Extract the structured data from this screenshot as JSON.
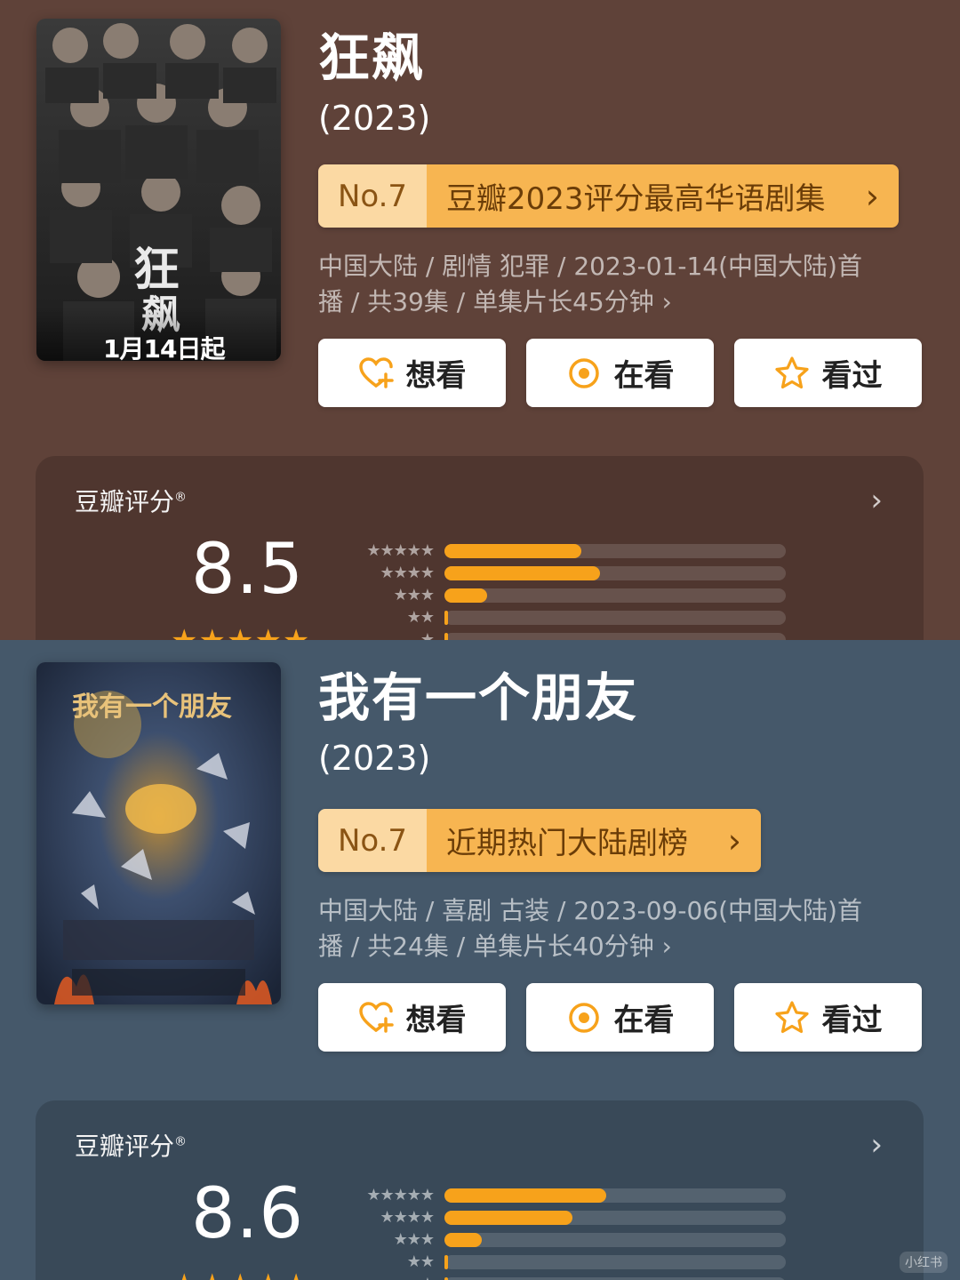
{
  "shows": [
    {
      "poster_caption": "1月14日起",
      "title": "狂飙",
      "year": "(2023)",
      "rank_no": "No.7",
      "rank_name": "豆瓣2023评分最高华语剧集",
      "meta_line1": "中国大陆 / 剧情 犯罪 / 2023-01-14(中国大陆)首",
      "meta_line2": "播 / 共39集 / 单集片长45分钟 ›",
      "actions": {
        "want": "想看",
        "watching": "在看",
        "watched": "看过"
      },
      "rating_label": "豆瓣评分",
      "score": "8.5",
      "distribution": [
        0.4,
        0.455,
        0.125,
        0.01,
        0.01
      ],
      "bg": "#5f4239"
    },
    {
      "poster_caption": "",
      "title": "我有一个朋友",
      "year": "(2023)",
      "rank_no": "No.7",
      "rank_name": "近期热门大陆剧榜",
      "meta_line1": "中国大陆 / 喜剧 古装 / 2023-09-06(中国大陆)首",
      "meta_line2": "播 / 共24集 / 单集片长40分钟 ›",
      "actions": {
        "want": "想看",
        "watching": "在看",
        "watched": "看过"
      },
      "rating_label": "豆瓣评分",
      "score": "8.6",
      "distribution": [
        0.475,
        0.375,
        0.11,
        0.01,
        0.01
      ],
      "bg": "#45586a"
    }
  ],
  "icons": {
    "want": "heart-plus-icon",
    "watching": "target-icon",
    "watched": "star-outline-icon",
    "chevron": "chevron-right-icon"
  },
  "colors": {
    "accent": "#f7a21b",
    "rank_bg": "#f7b551",
    "rank_no_bg": "#fbd9a3"
  },
  "watermark": "小红书"
}
